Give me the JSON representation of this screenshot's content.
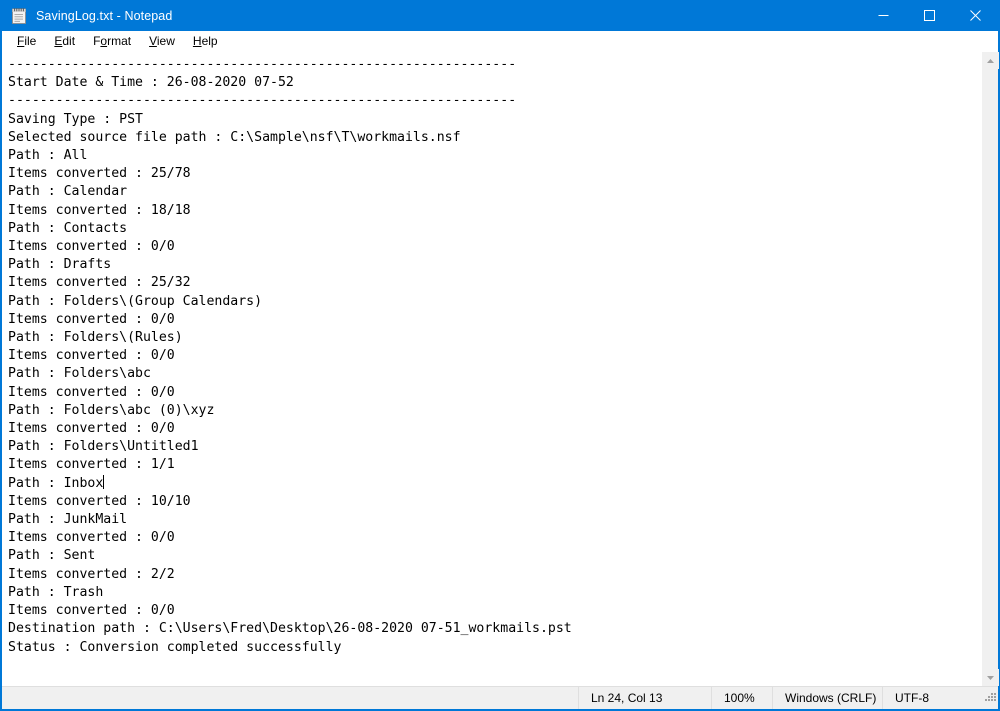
{
  "window": {
    "title": "SavingLog.txt - Notepad",
    "icon": "notepad-icon",
    "titlebar_color": "#0078d7",
    "controls": {
      "minimize": "Minimize",
      "maximize": "Maximize",
      "close": "Close"
    }
  },
  "menubar": {
    "items": [
      {
        "label": "File",
        "accel": "F",
        "rest": "ile"
      },
      {
        "label": "Edit",
        "accel": "E",
        "rest": "dit"
      },
      {
        "label": "Format",
        "accel": "F",
        "pre": "F",
        "rest": "ormat"
      },
      {
        "label": "View",
        "accel": "V",
        "rest": "iew"
      },
      {
        "label": "Help",
        "accel": "H",
        "rest": "elp"
      }
    ]
  },
  "document": {
    "filename": "SavingLog.txt",
    "caret_line": 24,
    "caret_col": 13,
    "caret_after_text": "Path : Inbox",
    "separator": "----------------------------------------------------------------",
    "lines": [
      "----------------------------------------------------------------",
      "Start Date & Time : 26-08-2020 07-52",
      "----------------------------------------------------------------",
      "Saving Type : PST",
      "Selected source file path : C:\\Sample\\nsf\\T\\workmails.nsf",
      "Path : All",
      "Items converted : 25/78",
      "Path : Calendar",
      "Items converted : 18/18",
      "Path : Contacts",
      "Items converted : 0/0",
      "Path : Drafts",
      "Items converted : 25/32",
      "Path : Folders\\(Group Calendars)",
      "Items converted : 0/0",
      "Path : Folders\\(Rules)",
      "Items converted : 0/0",
      "Path : Folders\\abc",
      "Items converted : 0/0",
      "Path : Folders\\abc (0)\\xyz",
      "Items converted : 0/0",
      "Path : Folders\\Untitled1",
      "Items converted : 1/1",
      "Path : Inbox",
      "Items converted : 10/10",
      "Path : JunkMail",
      "Items converted : 0/0",
      "Path : Sent",
      "Items converted : 2/2",
      "Path : Trash",
      "Items converted : 0/0",
      "Destination path : C:\\Users\\Fred\\Desktop\\26-08-2020 07-51_workmails.pst",
      "Status : Conversion completed successfully"
    ],
    "text_before_caret": "----------------------------------------------------------------\nStart Date & Time : 26-08-2020 07-52\n----------------------------------------------------------------\nSaving Type : PST\nSelected source file path : C:\\Sample\\nsf\\T\\workmails.nsf\nPath : All\nItems converted : 25/78\nPath : Calendar\nItems converted : 18/18\nPath : Contacts\nItems converted : 0/0\nPath : Drafts\nItems converted : 25/32\nPath : Folders\\(Group Calendars)\nItems converted : 0/0\nPath : Folders\\(Rules)\nItems converted : 0/0\nPath : Folders\\abc\nItems converted : 0/0\nPath : Folders\\abc (0)\\xyz\nItems converted : 0/0\nPath : Folders\\Untitled1\nItems converted : 1/1\nPath : Inbox",
    "text_after_caret": "\nItems converted : 10/10\nPath : JunkMail\nItems converted : 0/0\nPath : Sent\nItems converted : 2/2\nPath : Trash\nItems converted : 0/0\nDestination path : C:\\Users\\Fred\\Desktop\\26-08-2020 07-51_workmails.pst\nStatus : Conversion completed successfully"
  },
  "scrollbar": {
    "up_arrow": "chevron-up-icon",
    "down_arrow": "chevron-down-icon",
    "orientation": "vertical"
  },
  "statusbar": {
    "position": "Ln 24, Col 13",
    "zoom": "100%",
    "line_ending": "Windows (CRLF)",
    "encoding": "UTF-8"
  }
}
